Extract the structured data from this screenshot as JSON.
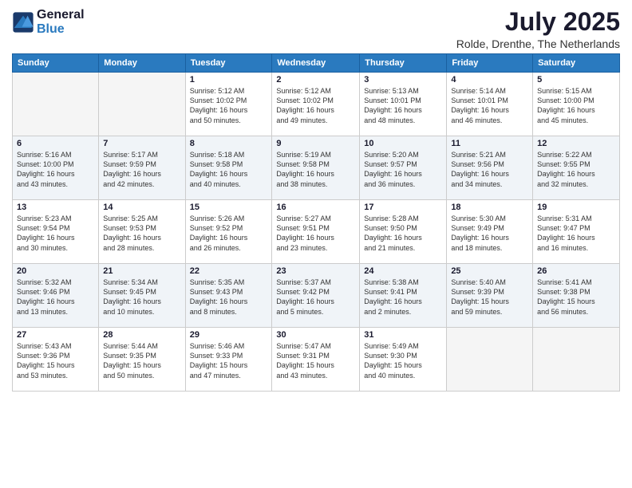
{
  "logo": {
    "line1": "General",
    "line2": "Blue"
  },
  "title": "July 2025",
  "subtitle": "Rolde, Drenthe, The Netherlands",
  "weekdays": [
    "Sunday",
    "Monday",
    "Tuesday",
    "Wednesday",
    "Thursday",
    "Friday",
    "Saturday"
  ],
  "weeks": [
    [
      {
        "day": "",
        "detail": ""
      },
      {
        "day": "",
        "detail": ""
      },
      {
        "day": "1",
        "detail": "Sunrise: 5:12 AM\nSunset: 10:02 PM\nDaylight: 16 hours\nand 50 minutes."
      },
      {
        "day": "2",
        "detail": "Sunrise: 5:12 AM\nSunset: 10:02 PM\nDaylight: 16 hours\nand 49 minutes."
      },
      {
        "day": "3",
        "detail": "Sunrise: 5:13 AM\nSunset: 10:01 PM\nDaylight: 16 hours\nand 48 minutes."
      },
      {
        "day": "4",
        "detail": "Sunrise: 5:14 AM\nSunset: 10:01 PM\nDaylight: 16 hours\nand 46 minutes."
      },
      {
        "day": "5",
        "detail": "Sunrise: 5:15 AM\nSunset: 10:00 PM\nDaylight: 16 hours\nand 45 minutes."
      }
    ],
    [
      {
        "day": "6",
        "detail": "Sunrise: 5:16 AM\nSunset: 10:00 PM\nDaylight: 16 hours\nand 43 minutes."
      },
      {
        "day": "7",
        "detail": "Sunrise: 5:17 AM\nSunset: 9:59 PM\nDaylight: 16 hours\nand 42 minutes."
      },
      {
        "day": "8",
        "detail": "Sunrise: 5:18 AM\nSunset: 9:58 PM\nDaylight: 16 hours\nand 40 minutes."
      },
      {
        "day": "9",
        "detail": "Sunrise: 5:19 AM\nSunset: 9:58 PM\nDaylight: 16 hours\nand 38 minutes."
      },
      {
        "day": "10",
        "detail": "Sunrise: 5:20 AM\nSunset: 9:57 PM\nDaylight: 16 hours\nand 36 minutes."
      },
      {
        "day": "11",
        "detail": "Sunrise: 5:21 AM\nSunset: 9:56 PM\nDaylight: 16 hours\nand 34 minutes."
      },
      {
        "day": "12",
        "detail": "Sunrise: 5:22 AM\nSunset: 9:55 PM\nDaylight: 16 hours\nand 32 minutes."
      }
    ],
    [
      {
        "day": "13",
        "detail": "Sunrise: 5:23 AM\nSunset: 9:54 PM\nDaylight: 16 hours\nand 30 minutes."
      },
      {
        "day": "14",
        "detail": "Sunrise: 5:25 AM\nSunset: 9:53 PM\nDaylight: 16 hours\nand 28 minutes."
      },
      {
        "day": "15",
        "detail": "Sunrise: 5:26 AM\nSunset: 9:52 PM\nDaylight: 16 hours\nand 26 minutes."
      },
      {
        "day": "16",
        "detail": "Sunrise: 5:27 AM\nSunset: 9:51 PM\nDaylight: 16 hours\nand 23 minutes."
      },
      {
        "day": "17",
        "detail": "Sunrise: 5:28 AM\nSunset: 9:50 PM\nDaylight: 16 hours\nand 21 minutes."
      },
      {
        "day": "18",
        "detail": "Sunrise: 5:30 AM\nSunset: 9:49 PM\nDaylight: 16 hours\nand 18 minutes."
      },
      {
        "day": "19",
        "detail": "Sunrise: 5:31 AM\nSunset: 9:47 PM\nDaylight: 16 hours\nand 16 minutes."
      }
    ],
    [
      {
        "day": "20",
        "detail": "Sunrise: 5:32 AM\nSunset: 9:46 PM\nDaylight: 16 hours\nand 13 minutes."
      },
      {
        "day": "21",
        "detail": "Sunrise: 5:34 AM\nSunset: 9:45 PM\nDaylight: 16 hours\nand 10 minutes."
      },
      {
        "day": "22",
        "detail": "Sunrise: 5:35 AM\nSunset: 9:43 PM\nDaylight: 16 hours\nand 8 minutes."
      },
      {
        "day": "23",
        "detail": "Sunrise: 5:37 AM\nSunset: 9:42 PM\nDaylight: 16 hours\nand 5 minutes."
      },
      {
        "day": "24",
        "detail": "Sunrise: 5:38 AM\nSunset: 9:41 PM\nDaylight: 16 hours\nand 2 minutes."
      },
      {
        "day": "25",
        "detail": "Sunrise: 5:40 AM\nSunset: 9:39 PM\nDaylight: 15 hours\nand 59 minutes."
      },
      {
        "day": "26",
        "detail": "Sunrise: 5:41 AM\nSunset: 9:38 PM\nDaylight: 15 hours\nand 56 minutes."
      }
    ],
    [
      {
        "day": "27",
        "detail": "Sunrise: 5:43 AM\nSunset: 9:36 PM\nDaylight: 15 hours\nand 53 minutes."
      },
      {
        "day": "28",
        "detail": "Sunrise: 5:44 AM\nSunset: 9:35 PM\nDaylight: 15 hours\nand 50 minutes."
      },
      {
        "day": "29",
        "detail": "Sunrise: 5:46 AM\nSunset: 9:33 PM\nDaylight: 15 hours\nand 47 minutes."
      },
      {
        "day": "30",
        "detail": "Sunrise: 5:47 AM\nSunset: 9:31 PM\nDaylight: 15 hours\nand 43 minutes."
      },
      {
        "day": "31",
        "detail": "Sunrise: 5:49 AM\nSunset: 9:30 PM\nDaylight: 15 hours\nand 40 minutes."
      },
      {
        "day": "",
        "detail": ""
      },
      {
        "day": "",
        "detail": ""
      }
    ]
  ]
}
